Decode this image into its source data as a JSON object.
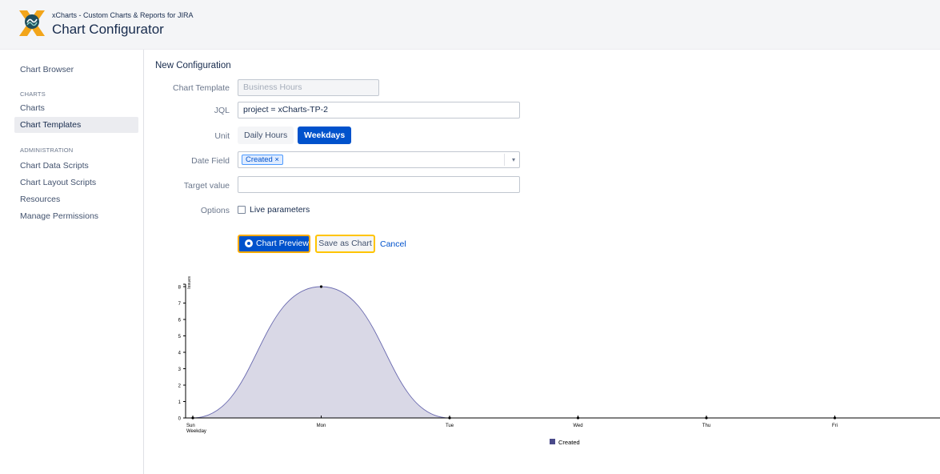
{
  "header": {
    "app_name": "xCharts - Custom Charts & Reports for JIRA",
    "page_title": "Chart Configurator"
  },
  "sidebar": {
    "items": [
      {
        "label": "Chart Browser"
      }
    ],
    "charts_heading": "CHARTS",
    "charts_items": [
      {
        "label": "Charts"
      },
      {
        "label": "Chart Templates",
        "active": true
      }
    ],
    "admin_heading": "ADMINISTRATION",
    "admin_items": [
      {
        "label": "Chart Data Scripts"
      },
      {
        "label": "Chart Layout Scripts"
      },
      {
        "label": "Resources"
      },
      {
        "label": "Manage Permissions"
      }
    ]
  },
  "form": {
    "title": "New Configuration",
    "template_label": "Chart Template",
    "template_value": "Business Hours",
    "jql_label": "JQL",
    "jql_value": "project = xCharts-TP-2",
    "unit_label": "Unit",
    "unit_options": [
      "Daily Hours",
      "Weekdays"
    ],
    "unit_selected": "Weekdays",
    "date_field_label": "Date Field",
    "date_field_chip": "Created ×",
    "target_label": "Target value",
    "target_value": "",
    "options_label": "Options",
    "live_params_label": "Live parameters",
    "live_params_checked": false,
    "preview_button": "Chart Preview",
    "save_button": "Save as Chart",
    "cancel_link": "Cancel"
  },
  "chart_data": {
    "type": "area",
    "x": [
      "Sun",
      "Mon",
      "Tue",
      "Wed",
      "Thu",
      "Fri"
    ],
    "series": [
      {
        "name": "Created",
        "values": [
          0,
          8,
          0,
          0,
          0,
          0
        ],
        "color": "#4a4a8a"
      }
    ],
    "xlabel": "Weekday",
    "ylabel": "Issues",
    "yticks": [
      0,
      1,
      2,
      3,
      4,
      5,
      6,
      7,
      8
    ],
    "ylim": [
      0,
      8
    ],
    "legend": "bottom-center",
    "grid": false
  }
}
